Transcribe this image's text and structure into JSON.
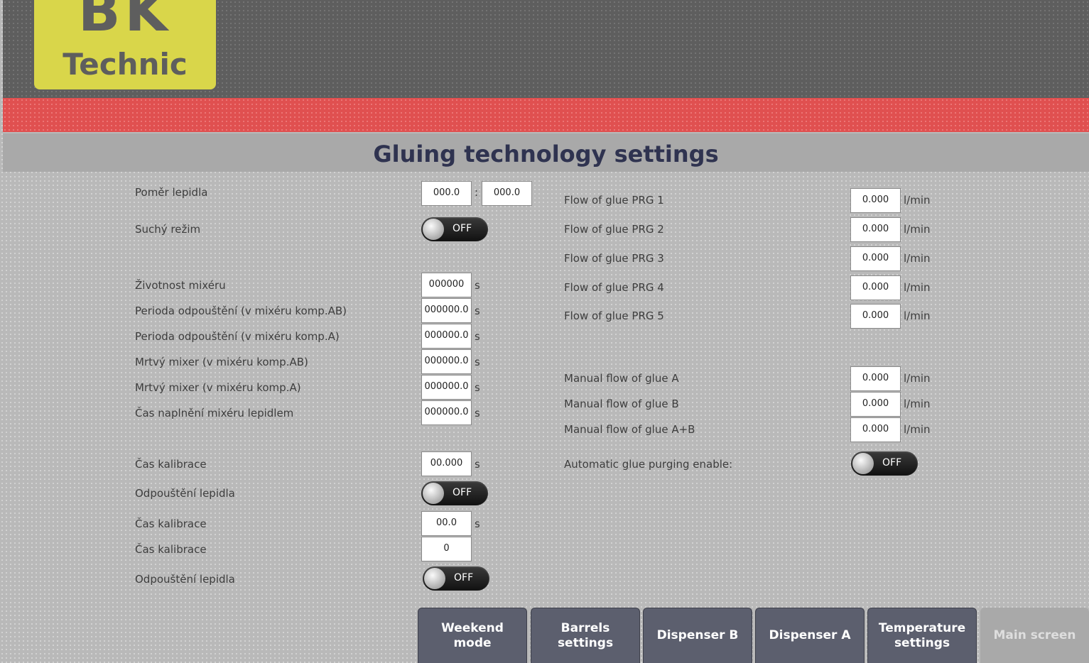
{
  "logo": {
    "line1": "BK",
    "line2": "Technic"
  },
  "page_title": "Gluing technology settings",
  "left": {
    "ratio": {
      "label": "Poměr lepidla",
      "value_a": "000.0",
      "separator": ":",
      "value_b": "000.0"
    },
    "dry_mode": {
      "label": "Suchý režim",
      "state": "OFF"
    },
    "mixer_life": {
      "label": "Životnost mixéru",
      "value": "000000",
      "unit": "s"
    },
    "bleed_period_ab": {
      "label": "Perioda odpouštění (v mixéru komp.AB)",
      "value": "000000.0",
      "unit": "s"
    },
    "bleed_period_a": {
      "label": "Perioda odpouštění (v mixéru komp.A)",
      "value": "000000.0",
      "unit": "s"
    },
    "dead_mixer_ab": {
      "label": "Mrtvý mixer (v mixéru komp.AB)",
      "value": "000000.0",
      "unit": "s"
    },
    "dead_mixer_a": {
      "label": "Mrtvý mixer (v mixéru komp.A)",
      "value": "000000.0",
      "unit": "s"
    },
    "fill_time": {
      "label": "Čas naplnění mixéru lepidlem",
      "value": "000000.0",
      "unit": "s"
    },
    "calib_time_1": {
      "label": "Čas kalibrace",
      "value": "00.000",
      "unit": "s"
    },
    "glue_bleed_1": {
      "label": "Odpouštění lepidla",
      "state": "OFF"
    },
    "calib_time_2": {
      "label": "Čas kalibrace",
      "value": "00.0",
      "unit": "s"
    },
    "calib_time_3": {
      "label": "Čas kalibrace",
      "value": "0"
    },
    "glue_bleed_2": {
      "label": "Odpouštění lepidla",
      "state": "OFF"
    }
  },
  "right": {
    "flows": [
      {
        "label": "Flow of glue PRG 1",
        "value": "0.000",
        "unit": "l/min"
      },
      {
        "label": "Flow of glue PRG 2",
        "value": "0.000",
        "unit": "l/min"
      },
      {
        "label": "Flow of glue PRG 3",
        "value": "0.000",
        "unit": "l/min"
      },
      {
        "label": "Flow of glue PRG 4",
        "value": "0.000",
        "unit": "l/min"
      },
      {
        "label": "Flow of glue PRG 5",
        "value": "0.000",
        "unit": "l/min"
      }
    ],
    "manual": [
      {
        "label": "Manual flow of glue A",
        "value": "0.000",
        "unit": "l/min"
      },
      {
        "label": "Manual flow of glue B",
        "value": "0.000",
        "unit": "l/min"
      },
      {
        "label": "Manual flow of glue A+B",
        "value": "0.000",
        "unit": "l/min"
      }
    ],
    "auto_purge": {
      "label": "Automatic glue purging enable:",
      "state": "OFF"
    }
  },
  "nav": {
    "weekend": "Weekend mode",
    "barrels": "Barrels settings",
    "disp_b": "Dispenser B",
    "disp_a": "Dispenser A",
    "temperature": "Temperature settings",
    "main": "Main screen"
  },
  "colors": {
    "header": "#5e5e5e",
    "logo": "#d9d64a",
    "alarm_band": "#e05050",
    "title": "#2f3350",
    "nav_button": "#5c5f6e"
  }
}
